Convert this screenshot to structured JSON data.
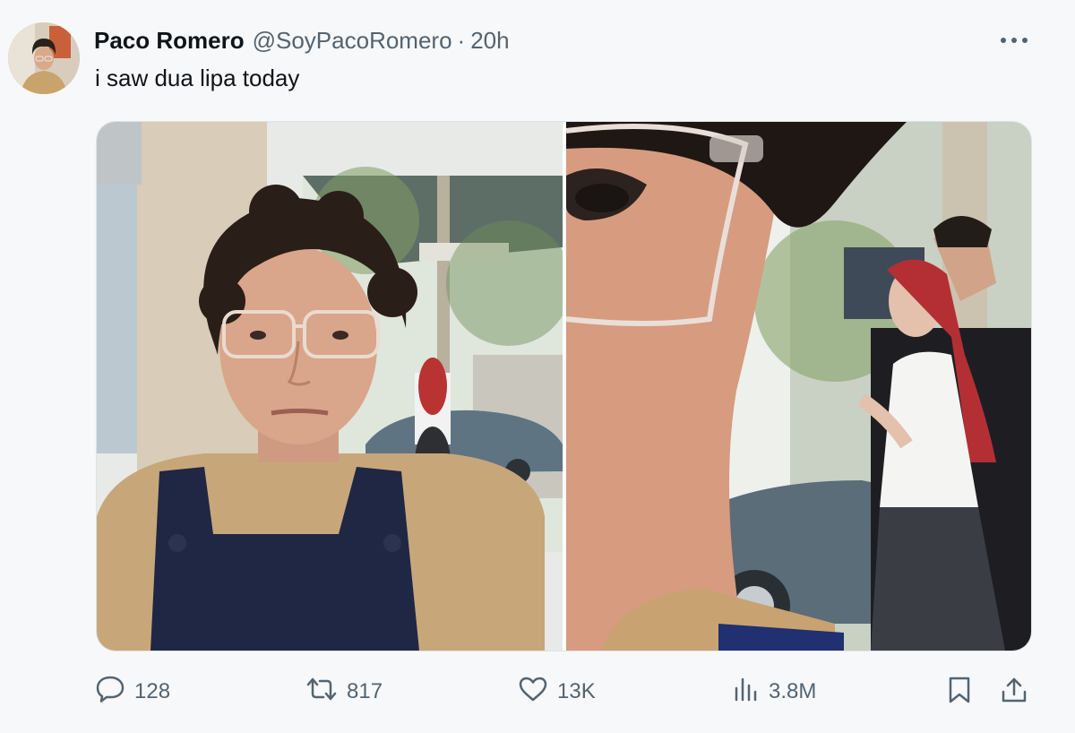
{
  "tweet": {
    "author_name": "Paco Romero",
    "handle": "@SoyPacoRomero",
    "separator": "·",
    "time": "20h",
    "text": "i saw dua lipa today"
  },
  "media": {
    "count": 2,
    "left_image": "selfie-with-glasses",
    "right_image": "close-up-with-woman-in-background"
  },
  "actions": {
    "replies": "128",
    "retweets": "817",
    "likes": "13K",
    "views": "3.8M"
  },
  "icons": [
    "more-icon",
    "reply-icon",
    "retweet-icon",
    "like-icon",
    "views-icon",
    "bookmark-icon",
    "share-icon"
  ],
  "colors": {
    "text": "#0f1419",
    "secondary": "#536471",
    "background": "#f7f8f9"
  }
}
